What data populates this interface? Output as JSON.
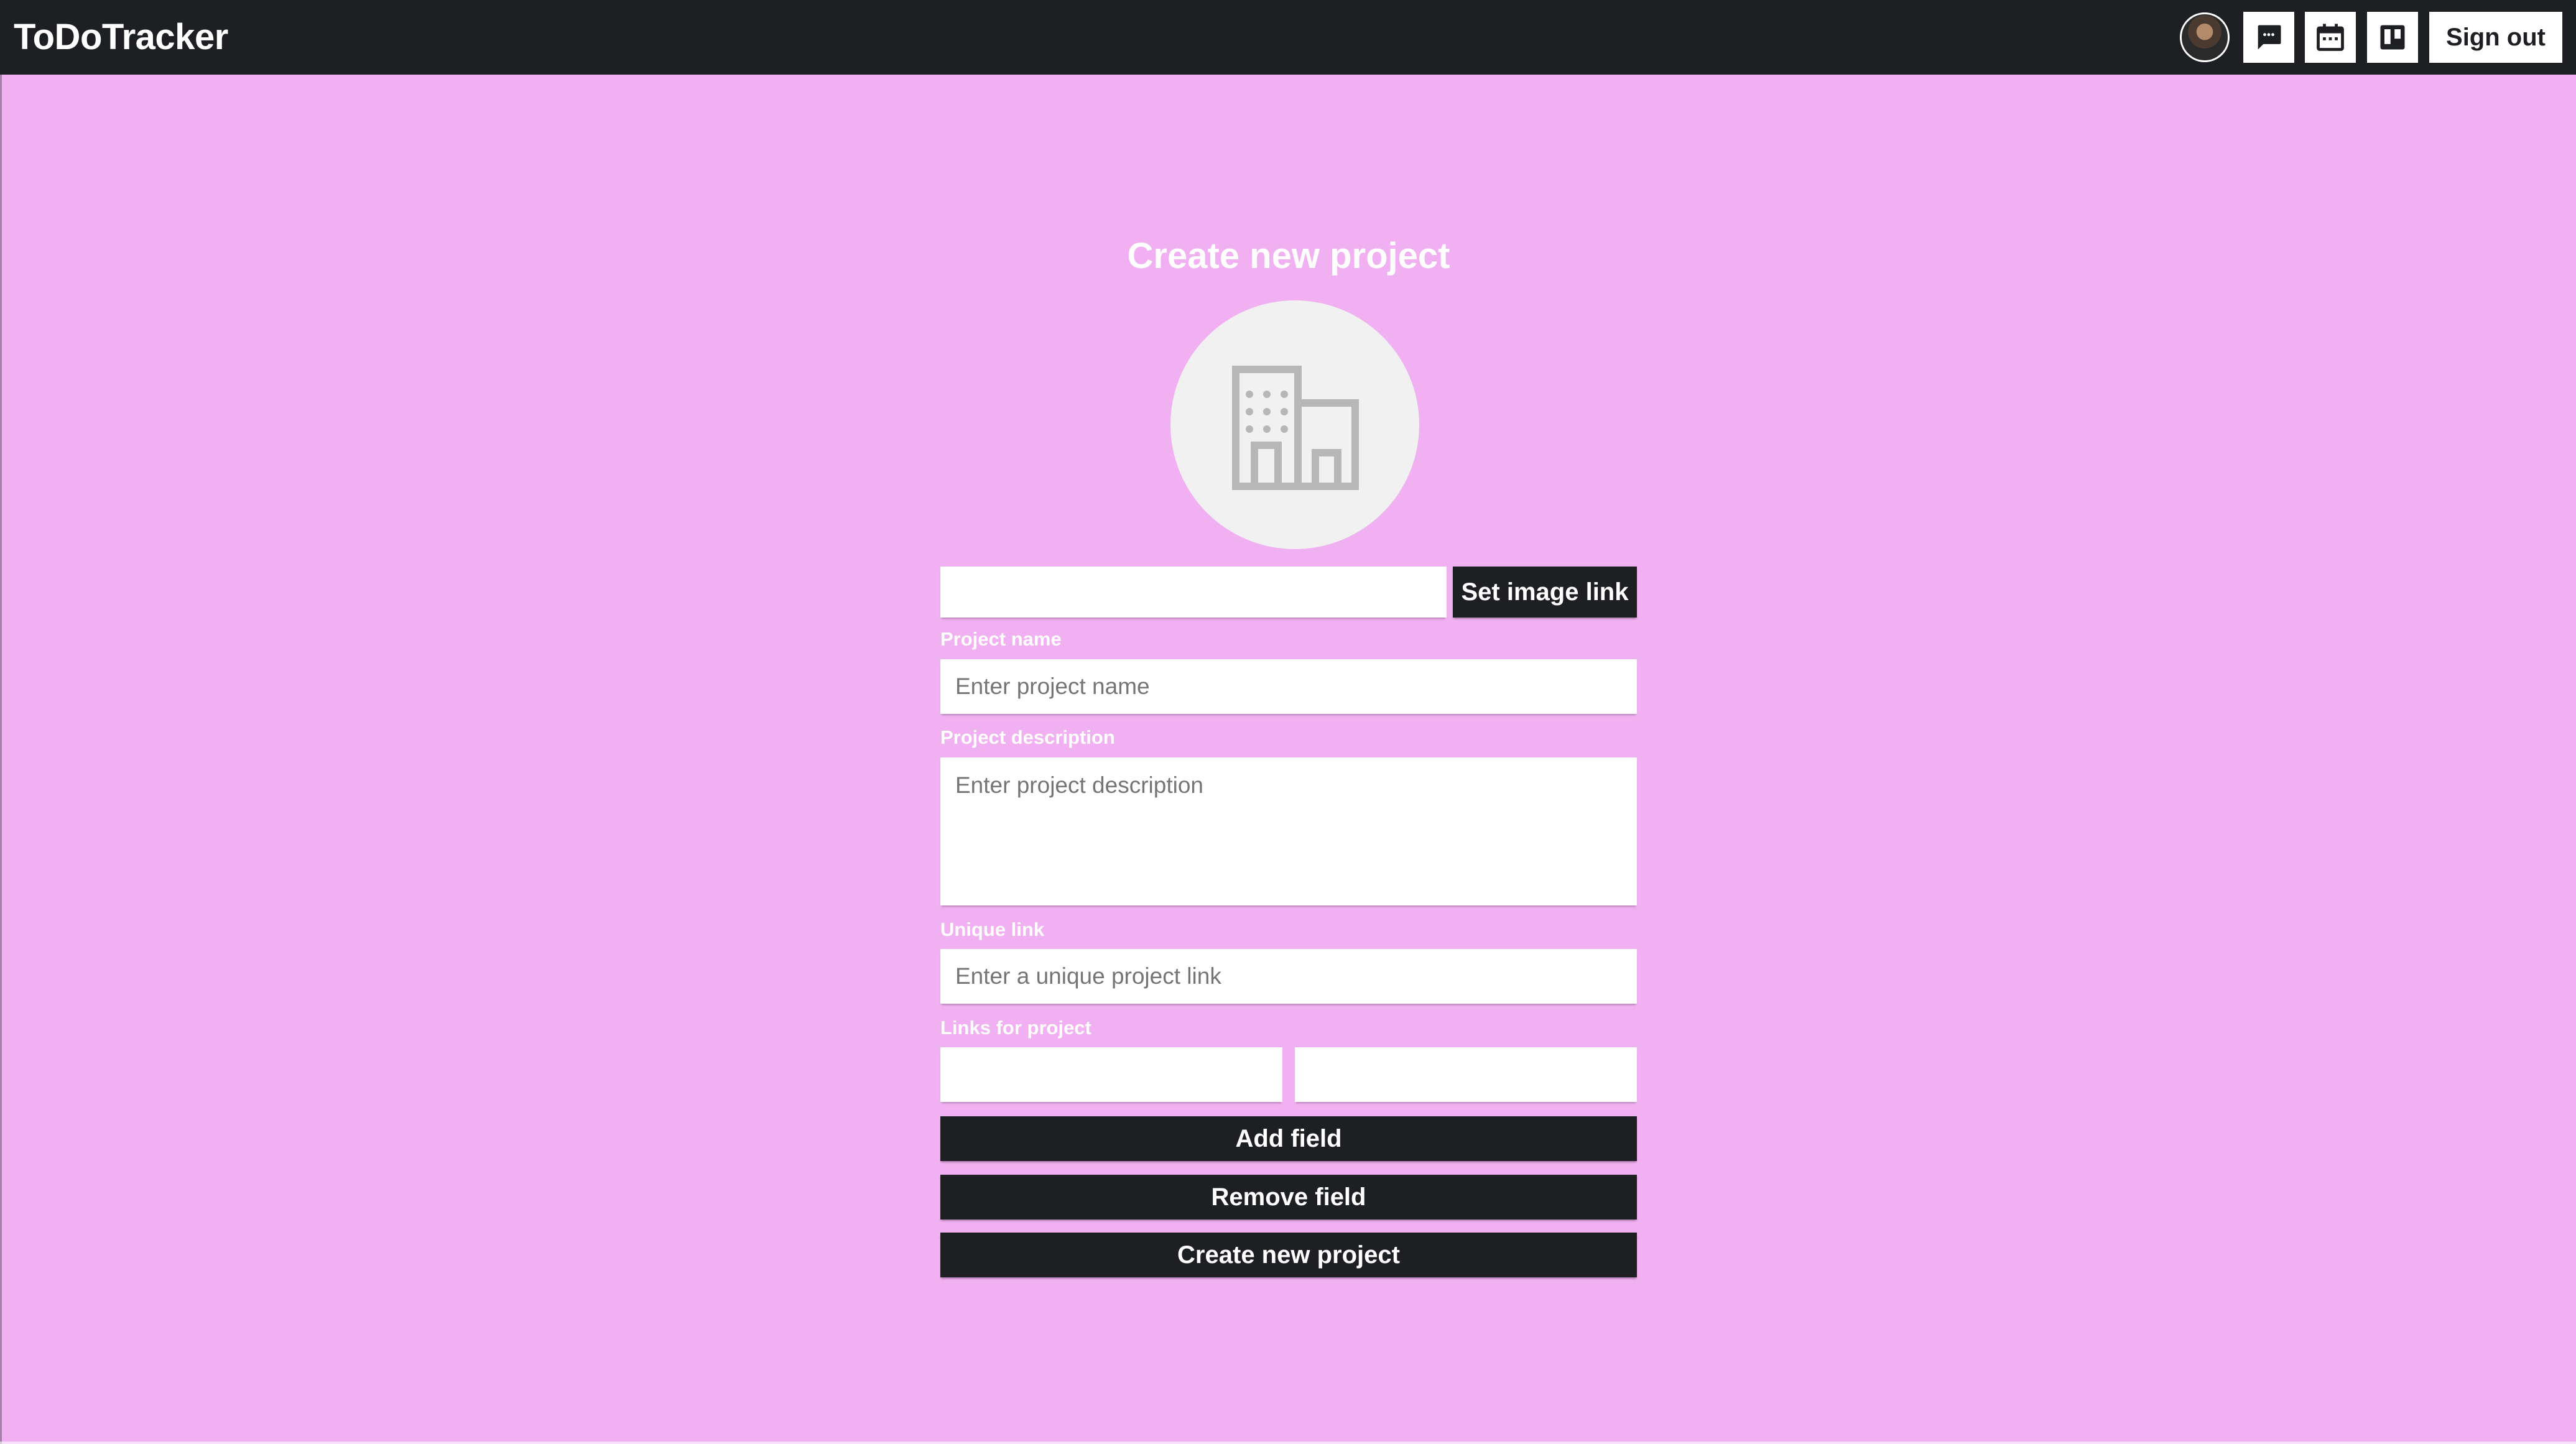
{
  "header": {
    "brand": "ToDoTracker",
    "icons": [
      "user-avatar",
      "chat-icon",
      "calendar-icon",
      "board-icon"
    ],
    "sign_out_label": "Sign out"
  },
  "form": {
    "title": "Create new project",
    "image_link": {
      "value": "",
      "button_label": "Set image link"
    },
    "project_name": {
      "label": "Project name",
      "placeholder": "Enter project name"
    },
    "project_description": {
      "label": "Project description",
      "placeholder": "Enter project description"
    },
    "unique_link": {
      "label": "Unique link",
      "placeholder": "Enter a unique project link"
    },
    "links": {
      "label": "Links for project",
      "fields": [
        "",
        ""
      ]
    },
    "add_field_label": "Add field",
    "remove_field_label": "Remove field",
    "submit_label": "Create new project"
  },
  "colors": {
    "background": "#f1b0f1",
    "header": "#1e1f23",
    "button": "#1e1f23",
    "placeholder_circle": "#f1f1f1",
    "placeholder_icon": "#b7b7b7"
  }
}
